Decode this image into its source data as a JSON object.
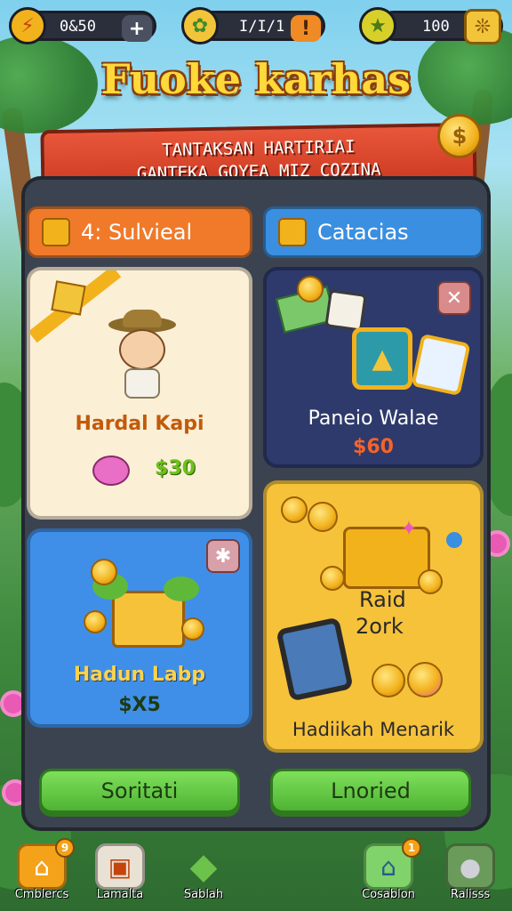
{
  "resources": {
    "energy": {
      "value": "0&50",
      "icon": "lightning-icon",
      "button": "+"
    },
    "gems": {
      "value": "I/I/1",
      "icon": "leaf-gem-icon",
      "button": "!"
    },
    "stars": {
      "value": "100",
      "icon": "star-creature-icon",
      "button": "puzzle-icon"
    }
  },
  "title": "Fuoke karhas",
  "ribbon": {
    "line1": "TANTAKSAN HARTIRIAI",
    "line2": "GANTEKA  GOYEA MIZ COZINA"
  },
  "tabs": [
    {
      "label": "4: Sulvieal",
      "color": "#f07a2a",
      "icon": "gold-block-icon"
    },
    {
      "label": "Catacias",
      "color": "#3a8fe0",
      "icon": "gold-block-icon"
    }
  ],
  "cards": {
    "hero": {
      "name": "Hardal Kapi",
      "price": "$30",
      "bg": "#fbefd6"
    },
    "pack": {
      "name": "Paneio Walae",
      "price": "$60",
      "bg": "#2e3a6b"
    },
    "cheese": {
      "name": "Hadun Labp",
      "price": "$X5",
      "bg": "#3f8fe8"
    },
    "gold": {
      "name1": "Raid",
      "name2": "2ork",
      "caption": "Hadiikah Menarik",
      "bg": "#f6c23a"
    }
  },
  "buttons": {
    "left": "Soritati",
    "right": "Lnoried"
  },
  "nav": [
    {
      "label": "Cmblercs",
      "icon": "home-icon",
      "badge": "9",
      "color": "#f4a21a"
    },
    {
      "label": "Lamalta",
      "icon": "chest-icon",
      "badge": "",
      "color": "#e9e1d4"
    },
    {
      "label": "Sablah",
      "icon": "green-gem-icon",
      "badge": "",
      "color": "#6cc24a"
    },
    {
      "label": "Cosablon",
      "icon": "shop-icon",
      "badge": "1",
      "color": "#7fd36a"
    },
    {
      "label": "Ralisss",
      "icon": "koala-icon",
      "badge": "",
      "color": "#6a9b5a"
    }
  ]
}
